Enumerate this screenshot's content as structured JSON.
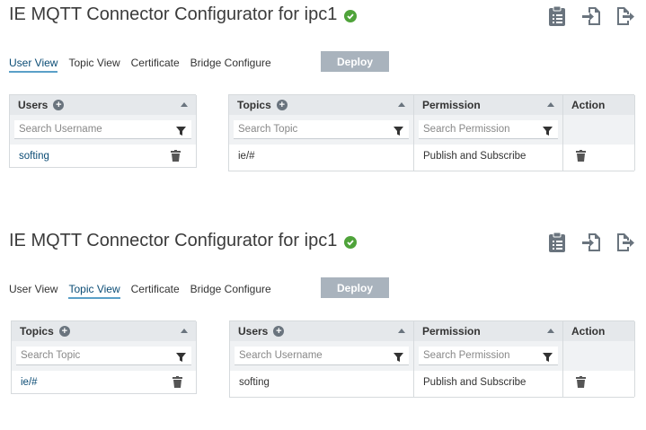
{
  "panels": [
    {
      "title": "IE MQTT Connector Configurator for ipc1",
      "tabs": [
        "User View",
        "Topic View",
        "Certificate",
        "Bridge Configure"
      ],
      "active_tab": "User View",
      "deploy_label": "Deploy",
      "left_table": {
        "header": "Users",
        "search_placeholder": "Search Username",
        "rows": [
          "softing"
        ]
      },
      "right_table": {
        "col1_header": "Topics",
        "col1_placeholder": "Search Topic",
        "col2_header": "Permission",
        "col2_placeholder": "Search Permission",
        "col3_header": "Action",
        "rows": [
          {
            "name": "ie/#",
            "permission": "Publish and Subscribe"
          }
        ]
      }
    },
    {
      "title": "IE MQTT Connector Configurator for ipc1",
      "tabs": [
        "User View",
        "Topic View",
        "Certificate",
        "Bridge Configure"
      ],
      "active_tab": "Topic View",
      "deploy_label": "Deploy",
      "left_table": {
        "header": "Topics",
        "search_placeholder": "Search Topic",
        "rows": [
          "ie/#"
        ]
      },
      "right_table": {
        "col1_header": "Users",
        "col1_placeholder": "Search Username",
        "col2_header": "Permission",
        "col2_placeholder": "Search Permission",
        "col3_header": "Action",
        "rows": [
          {
            "name": "softing",
            "permission": "Publish and Subscribe"
          }
        ]
      }
    }
  ],
  "icons": {
    "status": "check-circle-icon",
    "top": [
      "clipboard-icon",
      "import-icon",
      "export-icon"
    ],
    "add": "plus-circle-icon",
    "sort": "sort-up-icon",
    "filter": "filter-icon",
    "delete": "trash-icon"
  },
  "colors": {
    "status_ok": "#4fa33a",
    "active_tab": "#0b4c75",
    "deploy_button": "#a9b3bd",
    "icon_gray": "#6a747e",
    "header_bg": "#e5e8eb"
  }
}
